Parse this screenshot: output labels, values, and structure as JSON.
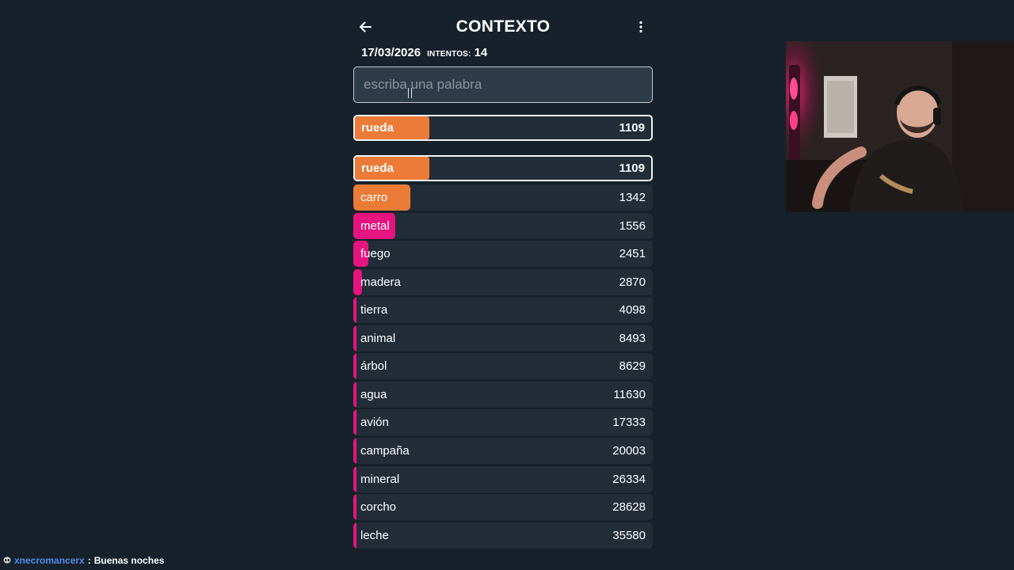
{
  "header": {
    "title": "CONTEXTO",
    "back_icon": "arrow-left-icon",
    "menu_icon": "kebab-menu-icon"
  },
  "meta": {
    "date": "17/03/2026",
    "attempts_label": "INTENTOS:",
    "attempts_count": "14"
  },
  "input": {
    "placeholder": "escriba una palabra",
    "value": ""
  },
  "colors": {
    "background": "#17212b",
    "row_background": "#222d38",
    "close_orange": "#ec7b37",
    "medium_pink": "#e6147f"
  },
  "last_guess": {
    "word": "rueda",
    "rank": "1109",
    "proximity": 0.25,
    "color": "#ec7b37"
  },
  "guesses": [
    {
      "word": "rueda",
      "rank": "1109",
      "proximity": 0.25,
      "color": "#ec7b37",
      "highlight": true
    },
    {
      "word": "carro",
      "rank": "1342",
      "proximity": 0.19,
      "color": "#ec7b37"
    },
    {
      "word": "metal",
      "rank": "1556",
      "proximity": 0.14,
      "color": "#e6147f"
    },
    {
      "word": "fuego",
      "rank": "2451",
      "proximity": 0.05,
      "color": "#e6147f"
    },
    {
      "word": "madera",
      "rank": "2870",
      "proximity": 0.03,
      "color": "#e6147f"
    },
    {
      "word": "tierra",
      "rank": "4098",
      "proximity": 0.01,
      "color": "#e6147f"
    },
    {
      "word": "animal",
      "rank": "8493",
      "proximity": 0.01,
      "color": "#e6147f"
    },
    {
      "word": "árbol",
      "rank": "8629",
      "proximity": 0.01,
      "color": "#e6147f"
    },
    {
      "word": "agua",
      "rank": "11630",
      "proximity": 0.01,
      "color": "#e6147f"
    },
    {
      "word": "avión",
      "rank": "17333",
      "proximity": 0.01,
      "color": "#e6147f"
    },
    {
      "word": "campaña",
      "rank": "20003",
      "proximity": 0.01,
      "color": "#e6147f"
    },
    {
      "word": "mineral",
      "rank": "26334",
      "proximity": 0.01,
      "color": "#e6147f"
    },
    {
      "word": "corcho",
      "rank": "28628",
      "proximity": 0.01,
      "color": "#e6147f"
    },
    {
      "word": "leche",
      "rank": "35580",
      "proximity": 0.01,
      "color": "#e6147f"
    }
  ],
  "chat": {
    "icon": "alien-badge-icon",
    "username": "xnecromancerx",
    "separator": ":",
    "message": "Buenas noches"
  }
}
